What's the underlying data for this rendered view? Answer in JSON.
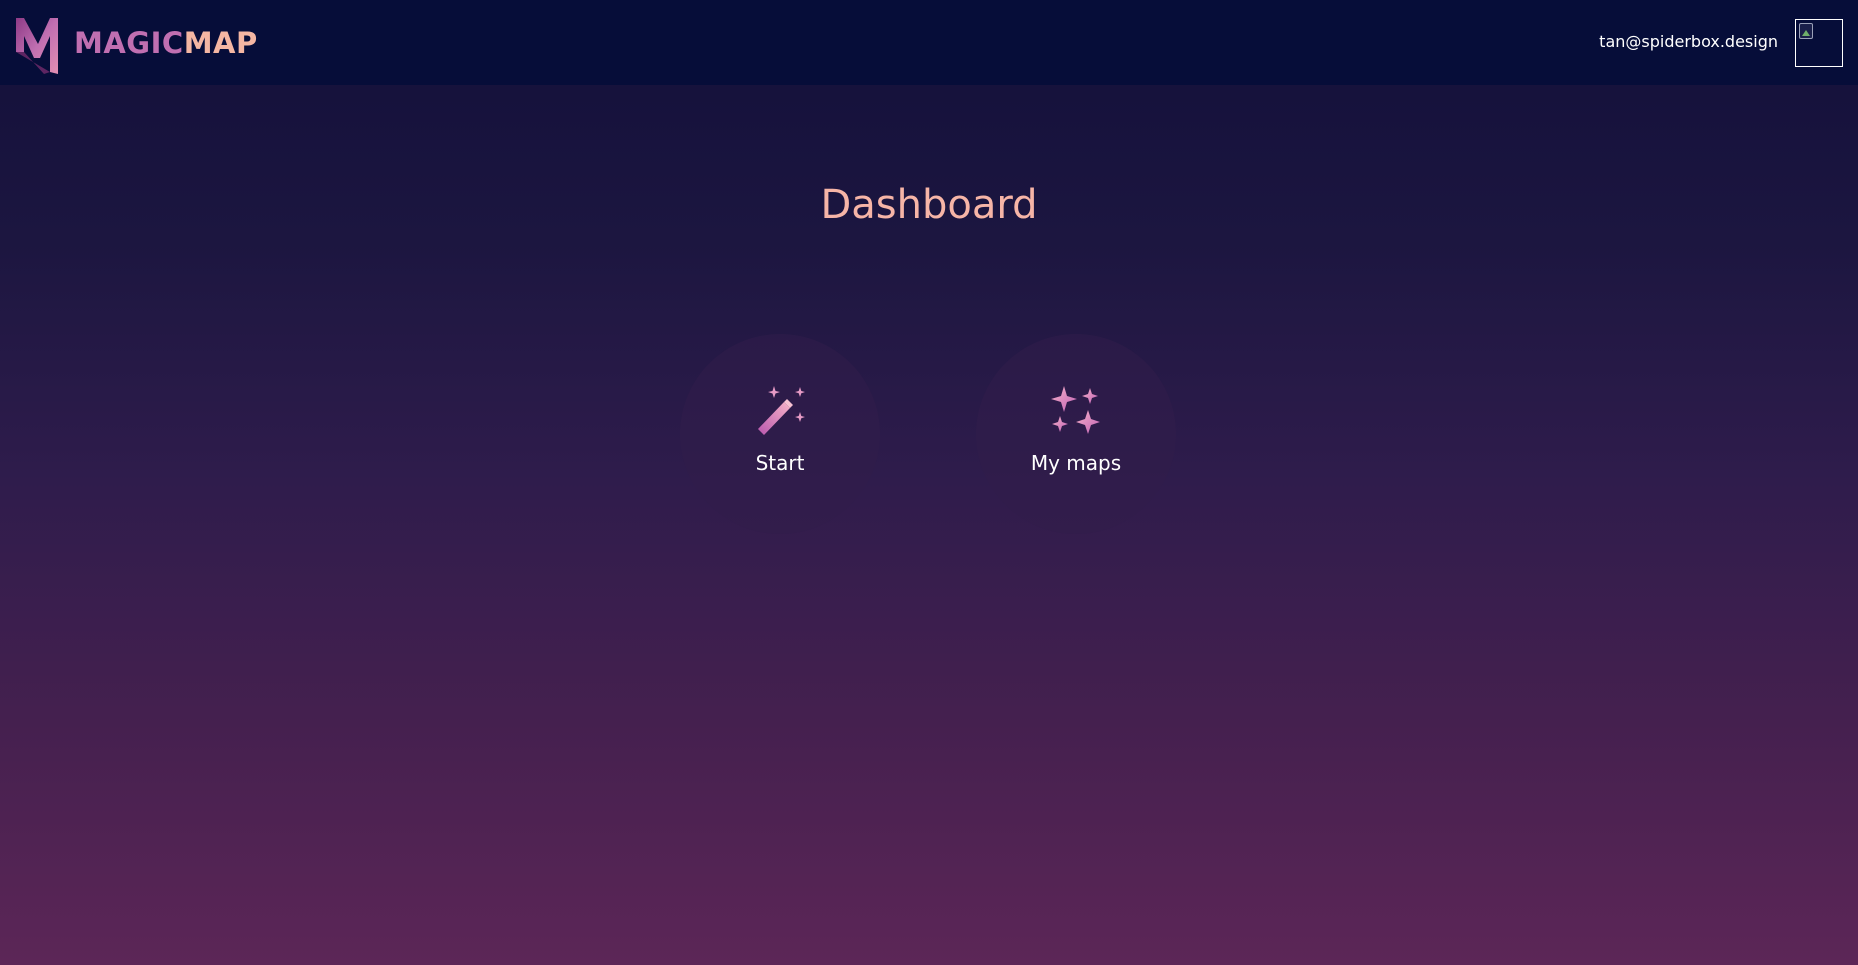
{
  "header": {
    "brand": {
      "part1": "MAGIC",
      "part2": "MAP"
    },
    "user_email": "tan@spiderbox.design",
    "avatar_icon": "broken-image-icon"
  },
  "page": {
    "title": "Dashboard"
  },
  "cards": [
    {
      "label": "Start",
      "icon": "magic-wand-icon"
    },
    {
      "label": "My maps",
      "icon": "sparkles-icon"
    }
  ],
  "colors": {
    "header_bg": "#060d39",
    "title": "#f6b5a7",
    "brand_pink": "#c06fb1",
    "brand_peach": "#f4b6a3",
    "icon_gradient_start": "#f5a9c9",
    "icon_gradient_end": "#c060b5",
    "background_top": "#120f3a",
    "background_bottom": "#5c2657"
  }
}
